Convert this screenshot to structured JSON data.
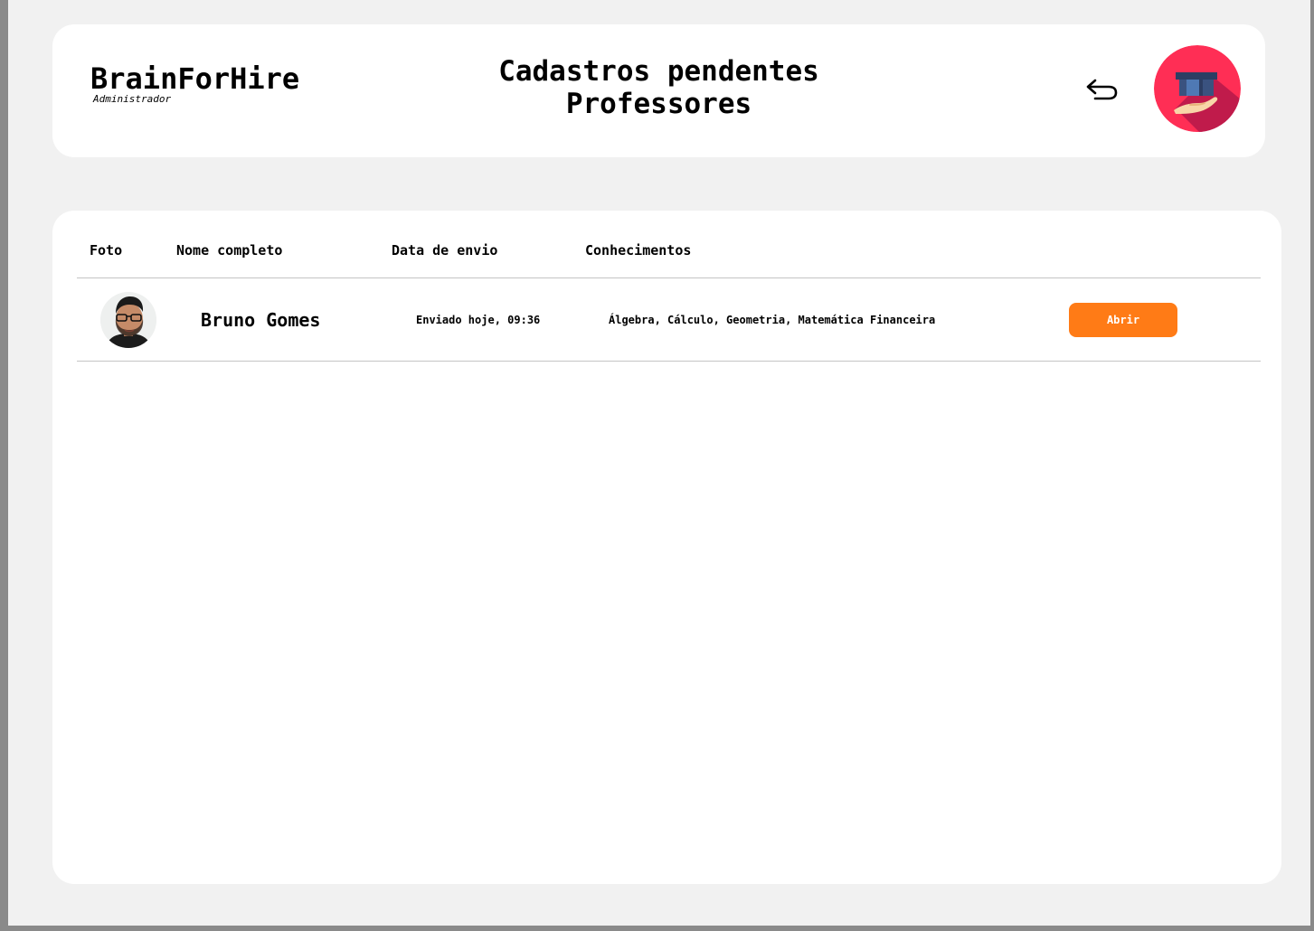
{
  "header": {
    "brand": "BrainForHire",
    "role": "Administrador",
    "title_line1": "Cadastros pendentes",
    "title_line2": "Professores",
    "back_icon": "undo-arrow-icon",
    "logo_icon": "graduation-cap-hand-logo"
  },
  "table": {
    "columns": [
      "Foto",
      "Nome completo",
      "Data de envio",
      "Conhecimentos",
      ""
    ],
    "rows": [
      {
        "photo": "avatar-photo",
        "name": "Bruno Gomes",
        "date": "Enviado hoje, 09:36",
        "skills": "Álgebra, Cálculo, Geometria, Matemática Financeira",
        "action": "Abrir"
      }
    ]
  },
  "colors": {
    "background": "#f1f1f1",
    "card": "#ffffff",
    "accent": "#ff7b16",
    "logo_circle": "#ff2e55"
  }
}
